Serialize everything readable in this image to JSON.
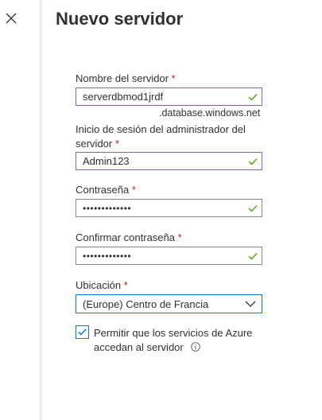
{
  "panel": {
    "title": "Nuevo servidor",
    "close_icon": "close-icon"
  },
  "form": {
    "required_marker": "*",
    "server_name": {
      "label": "Nombre del servidor",
      "value": "serverdbmod1jrdf",
      "suffix": ".database.windows.net",
      "valid": true
    },
    "admin_login": {
      "label": "Inicio de sesión del administrador del servidor",
      "value": "Admin123",
      "valid": true
    },
    "password": {
      "label": "Contraseña",
      "value": "•••••••••••••",
      "valid": true
    },
    "confirm_password": {
      "label": "Confirmar contraseña",
      "value": "•••••••••••••",
      "valid": true
    },
    "location": {
      "label": "Ubicación",
      "selected": "(Europe) Centro de Francia"
    },
    "allow_azure": {
      "checked": true,
      "label": "Permitir que los servicios de Azure accedan al servidor",
      "info_icon": "info-icon"
    }
  },
  "colors": {
    "valid_check": "#57a300",
    "focus_border": "#8764b8",
    "accent": "#0078d4",
    "required": "#a4262c"
  }
}
